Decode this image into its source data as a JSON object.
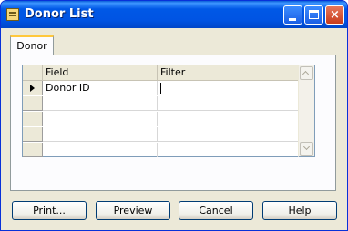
{
  "window": {
    "title": "Donor List",
    "controls": {
      "minimize_icon": "minimize-icon",
      "maximize_icon": "maximize-icon",
      "close_label": "×"
    }
  },
  "tabs": [
    {
      "label": "Donor",
      "selected": true
    }
  ],
  "grid": {
    "headers": {
      "field": "Field",
      "filter": "Filter"
    },
    "rows": [
      {
        "field": "Donor ID",
        "filter": "",
        "current": true
      },
      {
        "field": "",
        "filter": ""
      },
      {
        "field": "",
        "filter": ""
      },
      {
        "field": "",
        "filter": ""
      },
      {
        "field": "",
        "filter": ""
      }
    ]
  },
  "buttons": {
    "print": "Print...",
    "preview": "Preview",
    "cancel": "Cancel",
    "help": "Help"
  },
  "colors": {
    "titlebar": "#0054e3",
    "window_bg": "#ece9d8",
    "tab_accent": "#ffc83c",
    "button_border": "#003c74"
  }
}
